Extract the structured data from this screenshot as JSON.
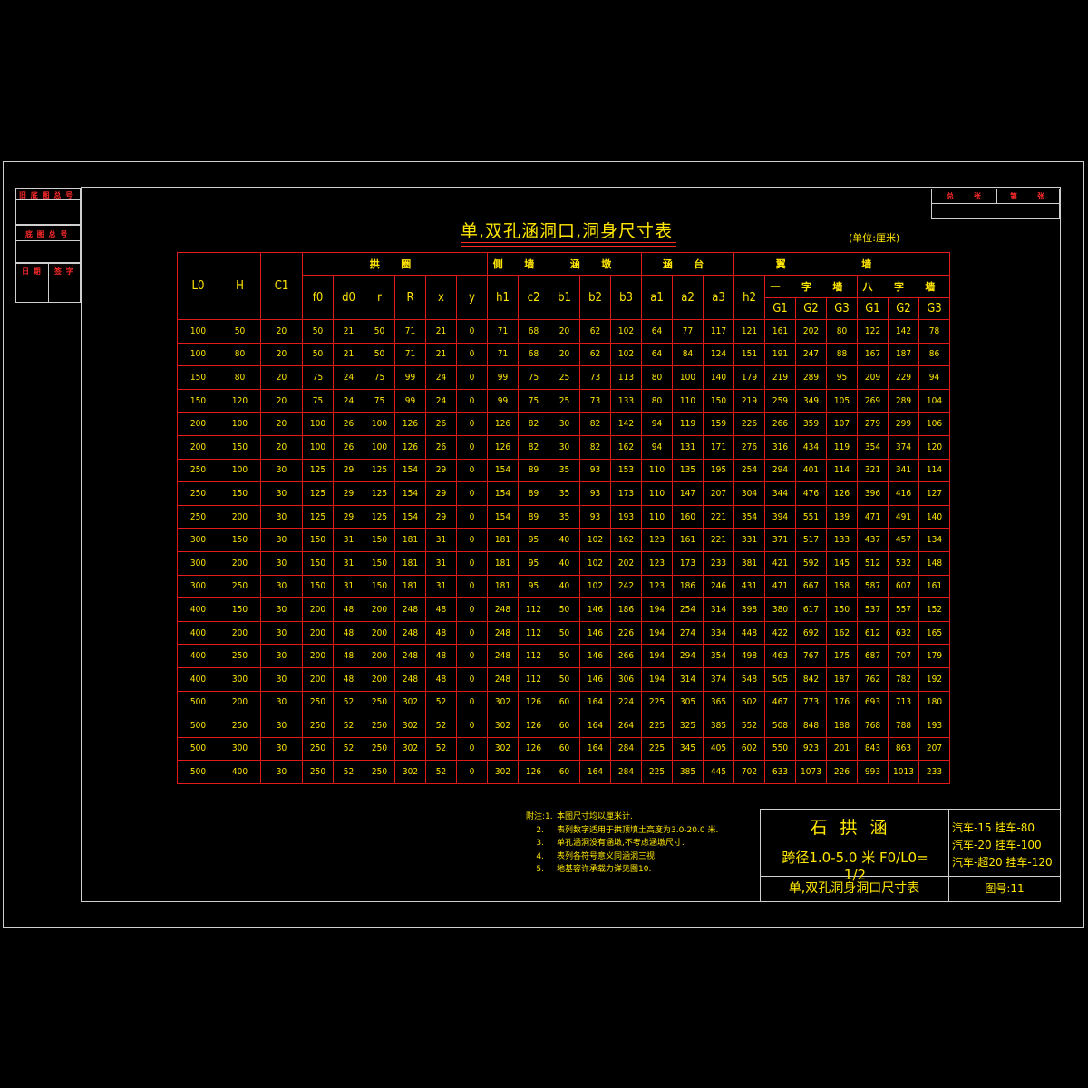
{
  "stamps": {
    "left_1": "旧 底 图 总 号",
    "left_2": "底 图 总 号",
    "left_3a": "日 期",
    "left_3b": "签 字",
    "top_right_a": "总",
    "top_right_b": "张",
    "top_right_c": "第",
    "top_right_d": "张"
  },
  "title": "单,双孔涵洞口,洞身尺寸表",
  "unit": "(单位:厘米)",
  "table": {
    "col_L0": "L0",
    "col_H": "H",
    "col_C1": "C1",
    "grp_arch": "拱 圈",
    "grp_sidewall": "侧 墙",
    "grp_culvertwall": "涵 墩",
    "grp_abutment": "涵 台",
    "grp_wingwall": "翼 墙",
    "grp_straight": "一 字 墙",
    "grp_eight": "八 字 墙",
    "sub_headers": [
      "f0",
      "d0",
      "r",
      "R",
      "x",
      "y",
      "h1",
      "c2",
      "b1",
      "b2",
      "b3",
      "a1",
      "a2",
      "a3",
      "h2",
      "G1",
      "G2",
      "G3",
      "G1",
      "G2",
      "G3"
    ],
    "rows": [
      [
        "100",
        "50",
        "20",
        "50",
        "21",
        "50",
        "71",
        "21",
        "0",
        "71",
        "68",
        "20",
        "62",
        "102",
        "64",
        "77",
        "117",
        "121",
        "161",
        "202",
        "80",
        "122",
        "142",
        "78"
      ],
      [
        "100",
        "80",
        "20",
        "50",
        "21",
        "50",
        "71",
        "21",
        "0",
        "71",
        "68",
        "20",
        "62",
        "102",
        "64",
        "84",
        "124",
        "151",
        "191",
        "247",
        "88",
        "167",
        "187",
        "86"
      ],
      [
        "150",
        "80",
        "20",
        "75",
        "24",
        "75",
        "99",
        "24",
        "0",
        "99",
        "75",
        "25",
        "73",
        "113",
        "80",
        "100",
        "140",
        "179",
        "219",
        "289",
        "95",
        "209",
        "229",
        "94"
      ],
      [
        "150",
        "120",
        "20",
        "75",
        "24",
        "75",
        "99",
        "24",
        "0",
        "99",
        "75",
        "25",
        "73",
        "133",
        "80",
        "110",
        "150",
        "219",
        "259",
        "349",
        "105",
        "269",
        "289",
        "104"
      ],
      [
        "200",
        "100",
        "20",
        "100",
        "26",
        "100",
        "126",
        "26",
        "0",
        "126",
        "82",
        "30",
        "82",
        "142",
        "94",
        "119",
        "159",
        "226",
        "266",
        "359",
        "107",
        "279",
        "299",
        "106"
      ],
      [
        "200",
        "150",
        "20",
        "100",
        "26",
        "100",
        "126",
        "26",
        "0",
        "126",
        "82",
        "30",
        "82",
        "162",
        "94",
        "131",
        "171",
        "276",
        "316",
        "434",
        "119",
        "354",
        "374",
        "120"
      ],
      [
        "250",
        "100",
        "30",
        "125",
        "29",
        "125",
        "154",
        "29",
        "0",
        "154",
        "89",
        "35",
        "93",
        "153",
        "110",
        "135",
        "195",
        "254",
        "294",
        "401",
        "114",
        "321",
        "341",
        "114"
      ],
      [
        "250",
        "150",
        "30",
        "125",
        "29",
        "125",
        "154",
        "29",
        "0",
        "154",
        "89",
        "35",
        "93",
        "173",
        "110",
        "147",
        "207",
        "304",
        "344",
        "476",
        "126",
        "396",
        "416",
        "127"
      ],
      [
        "250",
        "200",
        "30",
        "125",
        "29",
        "125",
        "154",
        "29",
        "0",
        "154",
        "89",
        "35",
        "93",
        "193",
        "110",
        "160",
        "221",
        "354",
        "394",
        "551",
        "139",
        "471",
        "491",
        "140"
      ],
      [
        "300",
        "150",
        "30",
        "150",
        "31",
        "150",
        "181",
        "31",
        "0",
        "181",
        "95",
        "40",
        "102",
        "162",
        "123",
        "161",
        "221",
        "331",
        "371",
        "517",
        "133",
        "437",
        "457",
        "134"
      ],
      [
        "300",
        "200",
        "30",
        "150",
        "31",
        "150",
        "181",
        "31",
        "0",
        "181",
        "95",
        "40",
        "102",
        "202",
        "123",
        "173",
        "233",
        "381",
        "421",
        "592",
        "145",
        "512",
        "532",
        "148"
      ],
      [
        "300",
        "250",
        "30",
        "150",
        "31",
        "150",
        "181",
        "31",
        "0",
        "181",
        "95",
        "40",
        "102",
        "242",
        "123",
        "186",
        "246",
        "431",
        "471",
        "667",
        "158",
        "587",
        "607",
        "161"
      ],
      [
        "400",
        "150",
        "30",
        "200",
        "48",
        "200",
        "248",
        "48",
        "0",
        "248",
        "112",
        "50",
        "146",
        "186",
        "194",
        "254",
        "314",
        "398",
        "380",
        "617",
        "150",
        "537",
        "557",
        "152"
      ],
      [
        "400",
        "200",
        "30",
        "200",
        "48",
        "200",
        "248",
        "48",
        "0",
        "248",
        "112",
        "50",
        "146",
        "226",
        "194",
        "274",
        "334",
        "448",
        "422",
        "692",
        "162",
        "612",
        "632",
        "165"
      ],
      [
        "400",
        "250",
        "30",
        "200",
        "48",
        "200",
        "248",
        "48",
        "0",
        "248",
        "112",
        "50",
        "146",
        "266",
        "194",
        "294",
        "354",
        "498",
        "463",
        "767",
        "175",
        "687",
        "707",
        "179"
      ],
      [
        "400",
        "300",
        "30",
        "200",
        "48",
        "200",
        "248",
        "48",
        "0",
        "248",
        "112",
        "50",
        "146",
        "306",
        "194",
        "314",
        "374",
        "548",
        "505",
        "842",
        "187",
        "762",
        "782",
        "192"
      ],
      [
        "500",
        "200",
        "30",
        "250",
        "52",
        "250",
        "302",
        "52",
        "0",
        "302",
        "126",
        "60",
        "164",
        "224",
        "225",
        "305",
        "365",
        "502",
        "467",
        "773",
        "176",
        "693",
        "713",
        "180"
      ],
      [
        "500",
        "250",
        "30",
        "250",
        "52",
        "250",
        "302",
        "52",
        "0",
        "302",
        "126",
        "60",
        "164",
        "264",
        "225",
        "325",
        "385",
        "552",
        "508",
        "848",
        "188",
        "768",
        "788",
        "193"
      ],
      [
        "500",
        "300",
        "30",
        "250",
        "52",
        "250",
        "302",
        "52",
        "0",
        "302",
        "126",
        "60",
        "164",
        "284",
        "225",
        "345",
        "405",
        "602",
        "550",
        "923",
        "201",
        "843",
        "863",
        "207"
      ],
      [
        "500",
        "400",
        "30",
        "250",
        "52",
        "250",
        "302",
        "52",
        "0",
        "302",
        "126",
        "60",
        "164",
        "284",
        "225",
        "385",
        "445",
        "702",
        "633",
        "1073",
        "226",
        "993",
        "1013",
        "233"
      ]
    ]
  },
  "notes": {
    "n1_num": "附注:1.",
    "n1": "本图尺寸均以厘米计.",
    "n2_num": "2.",
    "n2": "表列数字适用于拱顶填土高度为3.0-20.0 米.",
    "n3_num": "3.",
    "n3": "单孔涵洞没有涵墩,不考虑涵墩尺寸.",
    "n4_num": "4.",
    "n4": "表列各符号意义同涵洞三视.",
    "n5_num": "5.",
    "n5": "地基容许承载力详见图10."
  },
  "titleblock": {
    "project": "石拱涵",
    "span": "跨径1.0-5.0 米 F0/L0= 1/2",
    "load_1": "汽车-15 挂车-80",
    "load_2": "汽车-20 挂车-100",
    "load_3": "汽车-超20 挂车-120",
    "drawing_name": "单,双孔洞身洞口尺寸表",
    "drawing_no": "图号:11"
  }
}
